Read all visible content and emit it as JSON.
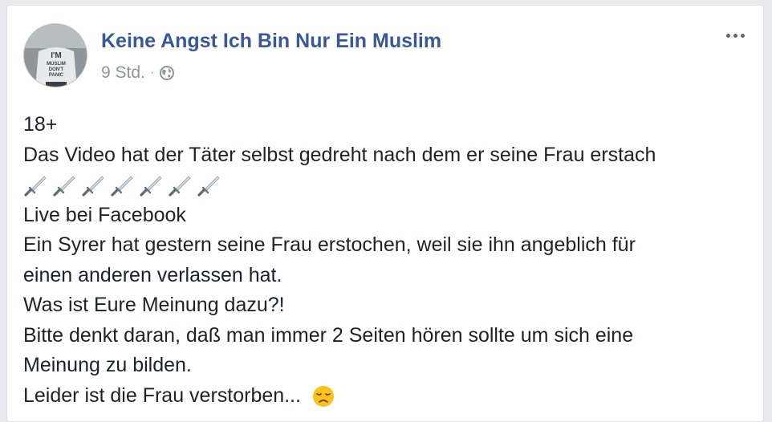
{
  "post": {
    "author": "Keine Angst Ich Bin Nur Ein Muslim",
    "time": "9 Std.",
    "separator": "·",
    "privacy_icon": "globe-icon",
    "more_icon": "more-options-icon",
    "avatar_shirt_text": [
      "I'M",
      "MUSLIM",
      "DON'T",
      "PANIC"
    ],
    "lines": [
      "18+",
      "Das Video hat der Täter selbst gedreht nach dem er seine Frau erstach",
      "",
      "Live bei Facebook",
      "Ein Syrer hat gestern seine Frau erstochen, weil sie ihn angeblich für",
      "einen anderen verlassen hat.",
      "Was ist Eure Meinung dazu?!",
      "Bitte denkt daran, daß man immer 2 Seiten hören sollte um sich eine",
      "Meinung zu bilden.",
      "Leider ist die Frau verstorben..."
    ],
    "dagger_emoji": "dagger-emoji",
    "dagger_count": 7,
    "sad_emoji": "disappointed-face-emoji"
  }
}
